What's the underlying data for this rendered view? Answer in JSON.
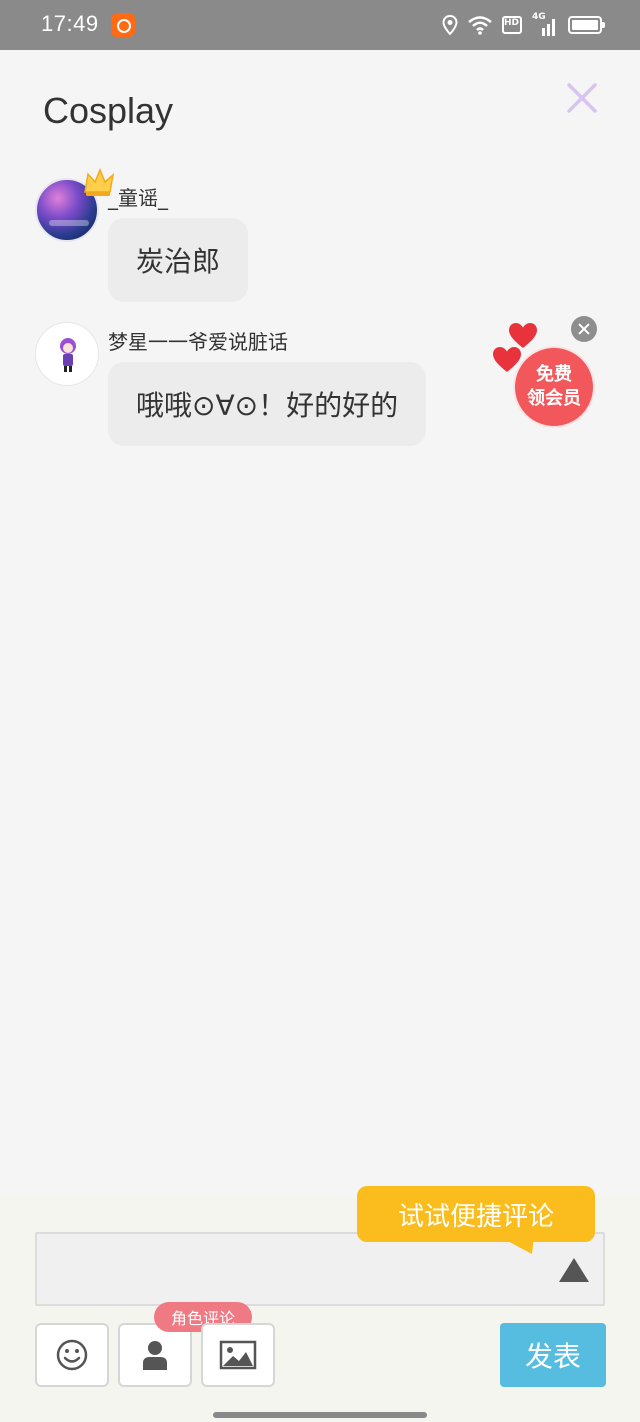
{
  "status_bar": {
    "time": "17:49",
    "network_label": "4G",
    "hd_label": "HD",
    "icons": [
      "app-badge-icon",
      "location-icon",
      "wifi-icon",
      "hd-icon",
      "signal-icon",
      "battery-icon"
    ]
  },
  "header": {
    "title": "Cosplay",
    "close_icon": "close-icon",
    "close_color": "#d7c4ef"
  },
  "messages": [
    {
      "username": "_童谣_",
      "text": "炭治郎",
      "badge": "crown-icon"
    },
    {
      "username": "梦星一一爷爱说脏话",
      "text": "哦哦⊙∀⊙！好的好的"
    }
  ],
  "promo": {
    "line1": "免费",
    "line2": "领会员",
    "color": "#f2585b"
  },
  "composer": {
    "tooltip": "试试便捷评论",
    "tooltip_color": "#fbbd1d",
    "input_value": "",
    "input_placeholder": "",
    "role_tag": "角色评论",
    "role_tag_color": "#ef7a83",
    "submit_label": "发表",
    "submit_color": "#56bde0",
    "tools": [
      "emoji-icon",
      "person-icon",
      "image-icon"
    ]
  }
}
